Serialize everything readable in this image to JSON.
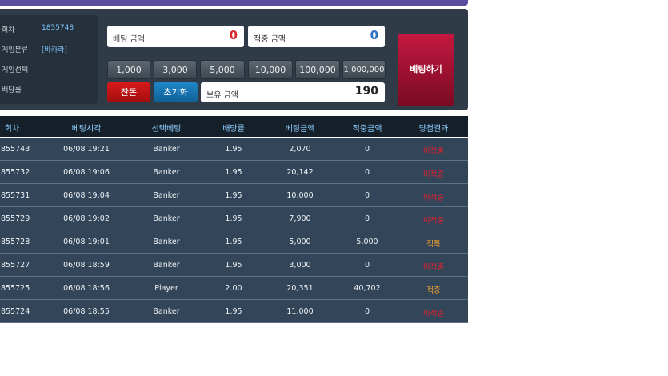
{
  "info": [
    {
      "label": "회차",
      "value": "1855748"
    },
    {
      "label": "게임분류",
      "value": "[바카라]"
    },
    {
      "label": "게임선택",
      "value": ""
    },
    {
      "label": "배당률",
      "value": ""
    }
  ],
  "betting": {
    "bet_label": "베팅 금액",
    "bet_value": "0",
    "win_label": "적중 금액",
    "win_value": "0",
    "balance_label": "보유 금액",
    "balance_value": "190",
    "chips": [
      "1,000",
      "3,000",
      "5,000",
      "10,000",
      "100,000",
      "1,000,000"
    ],
    "max_label": "잔돈",
    "reset_label": "초기화",
    "submit_label": "베팅하기",
    "colors": {
      "bet_value": "#d9272e",
      "win_value": "#2f6fbf"
    }
  },
  "history": {
    "headers": [
      "회차",
      "베팅시각",
      "선택베팅",
      "배당률",
      "베팅금액",
      "적중금액",
      "당첨결과"
    ],
    "rows": [
      [
        "855743",
        "06/08 19:21",
        "Banker",
        "1.95",
        "2,070",
        "0",
        "미적중"
      ],
      [
        "855732",
        "06/08 19:06",
        "Banker",
        "1.95",
        "20,142",
        "0",
        "미적중"
      ],
      [
        "855731",
        "06/08 19:04",
        "Banker",
        "1.95",
        "10,000",
        "0",
        "미적중"
      ],
      [
        "855729",
        "06/08 19:02",
        "Banker",
        "1.95",
        "7,900",
        "0",
        "미적중"
      ],
      [
        "855728",
        "06/08 19:01",
        "Banker",
        "1.95",
        "5,000",
        "5,000",
        "적특"
      ],
      [
        "855727",
        "06/08 18:59",
        "Banker",
        "1.95",
        "3,000",
        "0",
        "미적중"
      ],
      [
        "855725",
        "06/08 18:56",
        "Player",
        "2.00",
        "20,351",
        "40,702",
        "적중"
      ],
      [
        "855724",
        "06/08 18:55",
        "Banker",
        "1.95",
        "11,000",
        "0",
        "미적중"
      ]
    ],
    "result_colors": {
      "미적중": "#e3202f",
      "적특": "#f4a22d",
      "적중": "#f4a22d"
    }
  }
}
